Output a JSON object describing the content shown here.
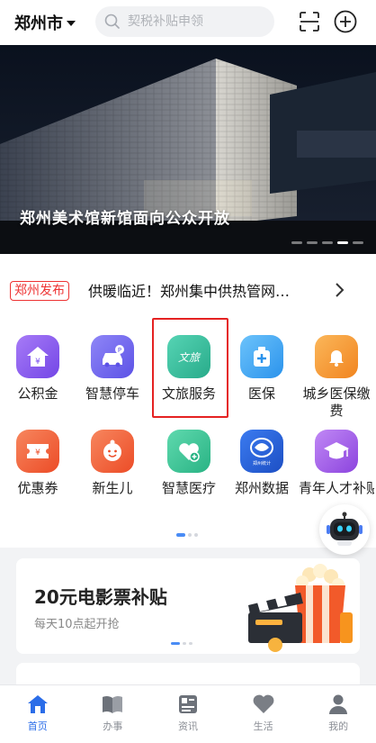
{
  "header": {
    "city": "郑州市",
    "search_placeholder": "契税补贴申领"
  },
  "banner": {
    "title": "郑州美术馆新馆面向公众开放",
    "slide_count": 5,
    "active_slide": 4
  },
  "news": {
    "badge": "郑州发布",
    "headline": "供暖临近！郑州集中供热管网…"
  },
  "services": [
    {
      "label": "公积金",
      "icon": "housing-fund-icon",
      "color": "#8a5cf0"
    },
    {
      "label": "智慧停车",
      "icon": "smart-parking-icon",
      "color": "#6c63f0"
    },
    {
      "label": "文旅服务",
      "icon": "culture-tourism-icon",
      "color": "#34c0a0"
    },
    {
      "label": "医保",
      "icon": "medical-insurance-icon",
      "color": "#3fa9f5"
    },
    {
      "label": "城乡医保缴费",
      "icon": "medical-payment-icon",
      "color": "#f59a2f"
    },
    {
      "label": "优惠券",
      "icon": "coupon-icon",
      "color": "#f2613a"
    },
    {
      "label": "新生儿",
      "icon": "newborn-icon",
      "color": "#f2613a"
    },
    {
      "label": "智慧医疗",
      "icon": "smart-healthcare-icon",
      "color": "#3fc59a"
    },
    {
      "label": "郑州数据",
      "icon": "zhengzhou-data-icon",
      "color": "#2f6ee8"
    },
    {
      "label": "青年人才补贴",
      "icon": "youth-talent-icon",
      "color": "#9a4fe0"
    }
  ],
  "data_logo_text": "郑州统计",
  "promo": {
    "title": "20元电影票补贴",
    "subtitle": "每天10点起开抢"
  },
  "tabs": [
    {
      "label": "首页",
      "icon": "home-icon",
      "active": true
    },
    {
      "label": "办事",
      "icon": "book-icon",
      "active": false
    },
    {
      "label": "资讯",
      "icon": "news-icon",
      "active": false
    },
    {
      "label": "生活",
      "icon": "heart-icon",
      "active": false
    },
    {
      "label": "我的",
      "icon": "user-icon",
      "active": false
    }
  ],
  "colors": {
    "accent": "#2b6de8",
    "highlight": "#e52222"
  }
}
